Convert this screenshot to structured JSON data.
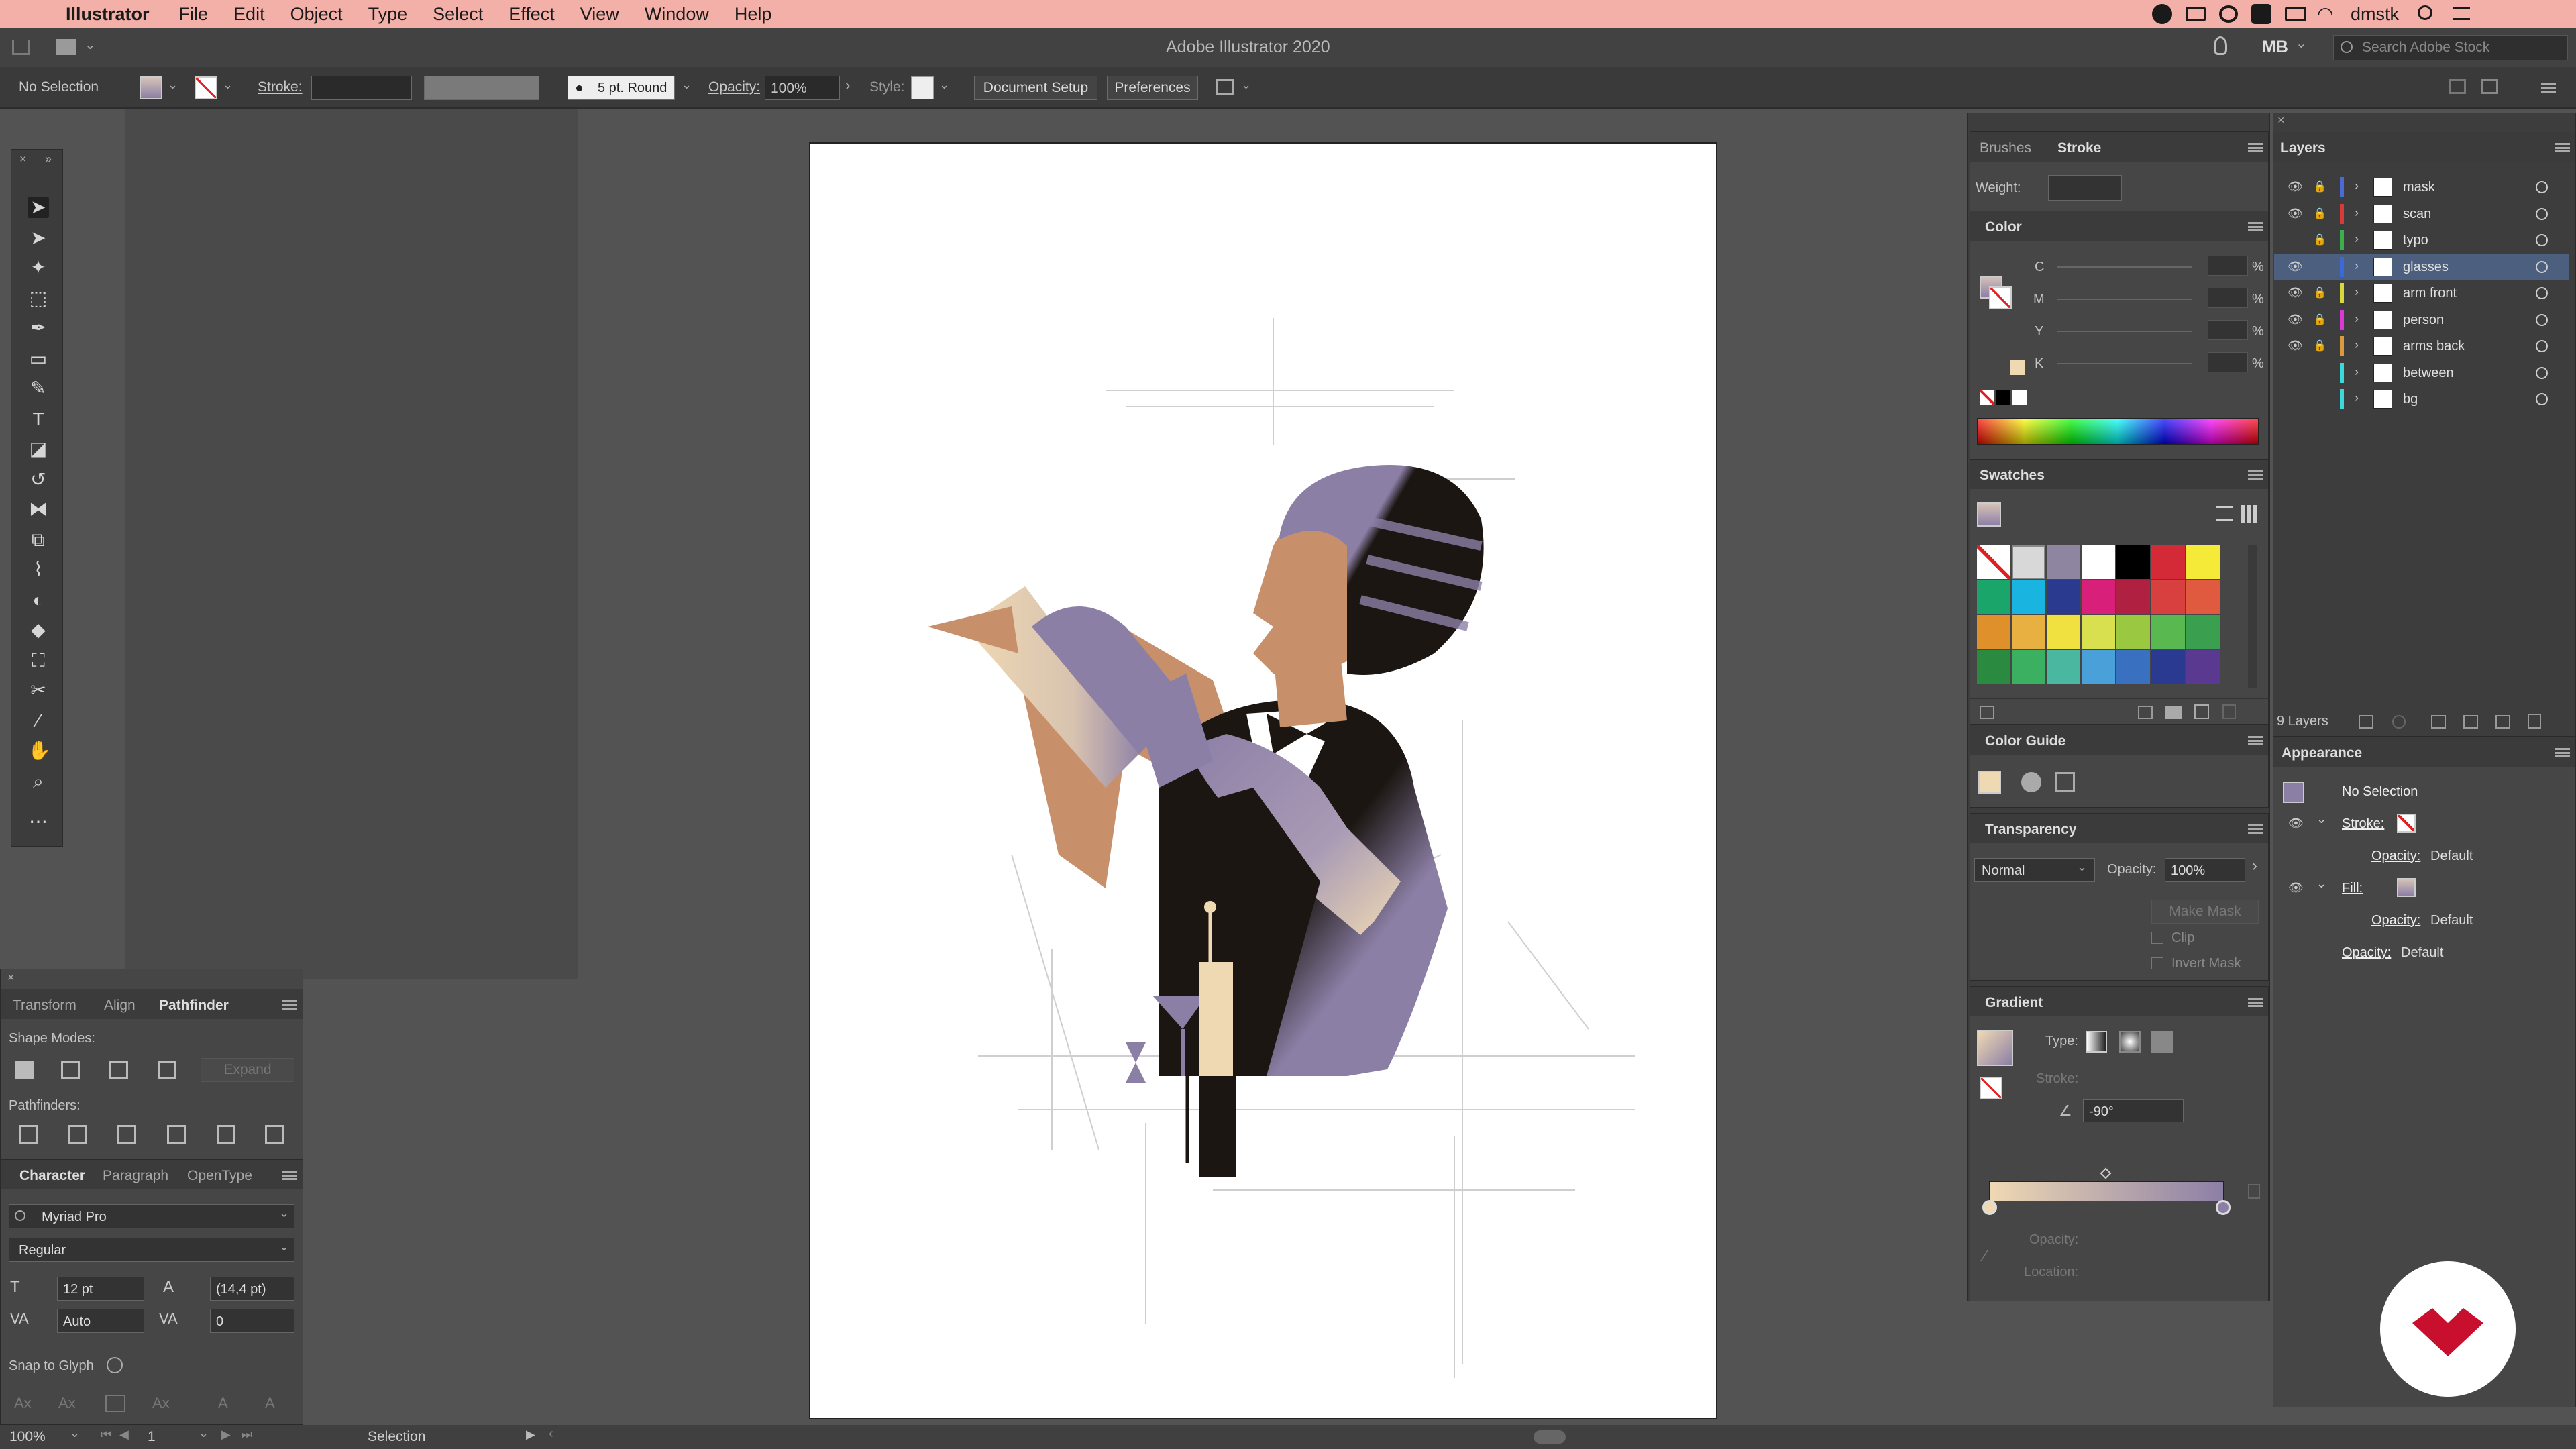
{
  "menubar": {
    "apple": "",
    "app_name": "Illustrator",
    "items": [
      "File",
      "Edit",
      "Object",
      "Type",
      "Select",
      "Effect",
      "View",
      "Window",
      "Help"
    ],
    "user": "dmstk"
  },
  "titlebar": {
    "title": "Adobe Illustrator 2020",
    "workspace": "MB",
    "search_placeholder": "Search Adobe Stock"
  },
  "control": {
    "selection": "No Selection",
    "stroke_label": "Stroke:",
    "brush": "5 pt. Round",
    "opacity_label": "Opacity:",
    "opacity_value": "100%",
    "style_label": "Style:",
    "document_setup": "Document Setup",
    "preferences": "Preferences"
  },
  "pathfinder_panel": {
    "tabs": [
      "Transform",
      "Align",
      "Pathfinder"
    ],
    "shape_modes": "Shape Modes:",
    "expand": "Expand",
    "pathfinders": "Pathfinders:"
  },
  "character_panel": {
    "tabs": [
      "Character",
      "Paragraph",
      "OpenType"
    ],
    "font": "Myriad Pro",
    "style": "Regular",
    "size": "12 pt",
    "leading": "(14,4 pt)",
    "kerning": "Auto",
    "tracking": "0",
    "snap": "Snap to Glyph"
  },
  "brush_stroke_panel": {
    "tabs": [
      "Brushes",
      "Stroke"
    ],
    "weight_label": "Weight:"
  },
  "color_panel": {
    "title": "Color",
    "channels": [
      "C",
      "M",
      "Y",
      "K"
    ],
    "pct": "%"
  },
  "swatches_panel": {
    "title": "Swatches",
    "colors": [
      "#ffffff",
      "#d8d8d8",
      "#8e86a0",
      "#ffffff",
      "#000000",
      "#d42a38",
      "#f5ea38",
      "#1aa56a",
      "#1ab4e0",
      "#2a3a8e",
      "#d8207a",
      "#b02040",
      "#d84040",
      "#e05a40",
      "#e0902a",
      "#e8b040",
      "#f0e040",
      "#d8e050",
      "#9ac840",
      "#5ab850",
      "#3aa050",
      "#2a8a40",
      "#3ab060",
      "#4ab8a0",
      "#4aa0d8",
      "#3a70c0",
      "#2a3a90",
      "#5a3a90"
    ]
  },
  "color_guide_panel": {
    "title": "Color Guide"
  },
  "transparency_panel": {
    "title": "Transparency",
    "mode": "Normal",
    "opacity_label": "Opacity:",
    "opacity_value": "100%",
    "make_mask": "Make Mask",
    "clip": "Clip",
    "invert_mask": "Invert Mask"
  },
  "gradient_panel": {
    "title": "Gradient",
    "type_label": "Type:",
    "stroke_label": "Stroke:",
    "angle": "-90°",
    "opacity_label": "Opacity:",
    "location_label": "Location:"
  },
  "layers_panel": {
    "title": "Layers",
    "count": "9 Layers",
    "layers": [
      {
        "name": "mask",
        "color": "#4a6ad8",
        "eye": true,
        "lock": true
      },
      {
        "name": "scan",
        "color": "#d83a3a",
        "eye": true,
        "lock": true
      },
      {
        "name": "typo",
        "color": "#3ab04a",
        "eye": false,
        "lock": true
      },
      {
        "name": "glasses",
        "color": "#3a6ad8",
        "eye": true,
        "lock": false
      },
      {
        "name": "arm front",
        "color": "#d8d83a",
        "eye": true,
        "lock": true
      },
      {
        "name": "person",
        "color": "#d83ad8",
        "eye": true,
        "lock": true
      },
      {
        "name": "arms back",
        "color": "#d89a3a",
        "eye": true,
        "lock": true
      },
      {
        "name": "between",
        "color": "#3ad8d8",
        "eye": false,
        "lock": false
      },
      {
        "name": "bg",
        "color": "#3ad8d8",
        "eye": false,
        "lock": false
      }
    ]
  },
  "appearance_panel": {
    "title": "Appearance",
    "selection": "No Selection",
    "stroke": "Stroke:",
    "opacity1": "Opacity:",
    "default1": "Default",
    "fill": "Fill:",
    "opacity2": "Opacity:",
    "default2": "Default",
    "opacity3": "Opacity:",
    "default3": "Default"
  },
  "status": {
    "zoom": "100%",
    "artboard": "1",
    "tool": "Selection"
  },
  "colors": {
    "menubar": "#f2b0a8",
    "purple": "#8c7fa6",
    "tan": "#c8906a",
    "dark": "#1c1612",
    "cream": "#efd9b3",
    "logo_red": "#c8102e"
  }
}
